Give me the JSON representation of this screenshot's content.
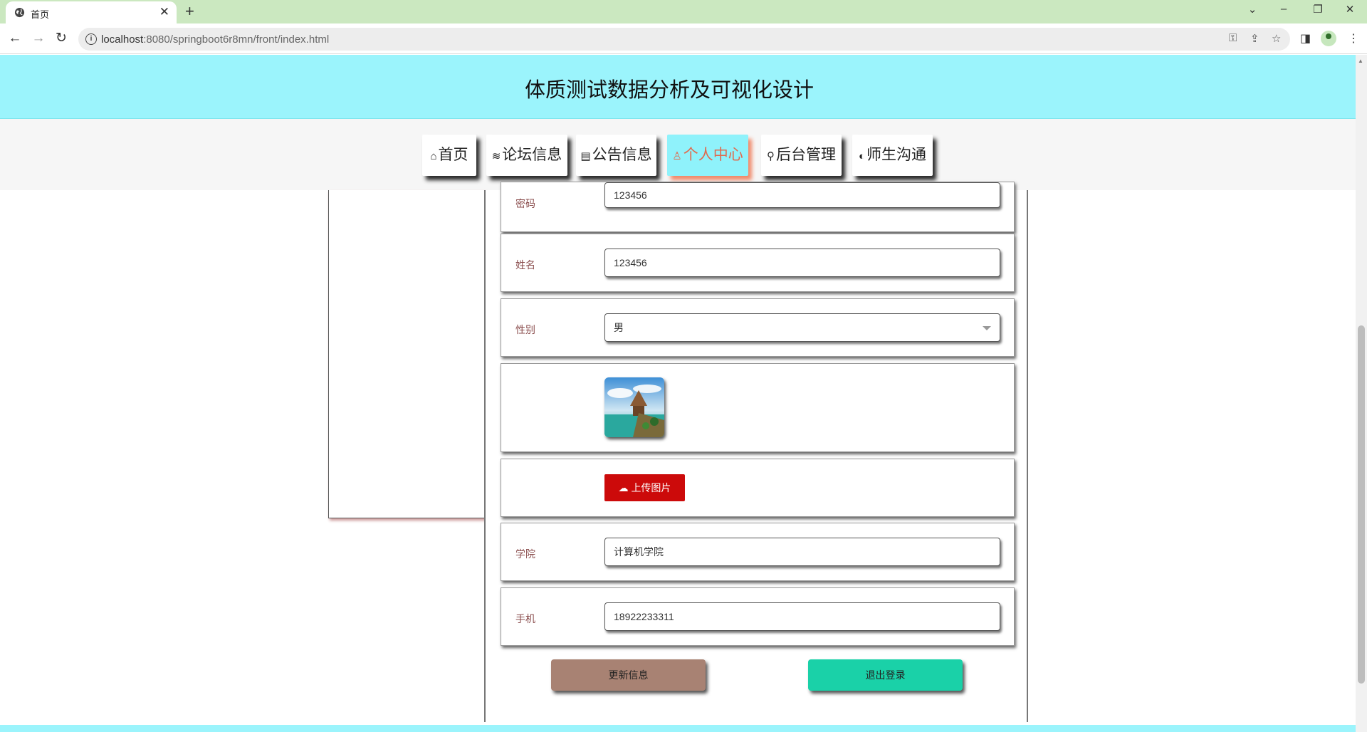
{
  "browser": {
    "tab_title": "首页",
    "tab_close": "✕",
    "new_tab": "+",
    "url_host": "localhost",
    "url_rest": ":8080/springboot6r8mn/front/index.html",
    "controls": {
      "dropdown": "⌄",
      "minimize": "–",
      "restore": "❐",
      "close": "✕"
    },
    "nav": {
      "back": "←",
      "forward": "→",
      "reload": "↻"
    }
  },
  "site": {
    "title": "体质测试数据分析及可视化设计"
  },
  "navbar": {
    "items": [
      {
        "icon": "⌂",
        "label": "首页"
      },
      {
        "icon": "≋",
        "label": "论坛信息"
      },
      {
        "icon": "▤",
        "label": "公告信息"
      },
      {
        "icon": "♙",
        "label": "个人中心"
      },
      {
        "icon": "⚲",
        "label": "后台管理"
      },
      {
        "icon": "◐",
        "label": "师生沟通"
      }
    ],
    "active_index": 3
  },
  "form": {
    "password": {
      "label": "密码",
      "value": "123456"
    },
    "name": {
      "label": "姓名",
      "value": "123456"
    },
    "gender": {
      "label": "性别",
      "value": "男"
    },
    "upload_label": "上传图片",
    "college": {
      "label": "学院",
      "value": "计算机学院"
    },
    "phone": {
      "label": "手机",
      "value": "18922233311"
    },
    "update_button": "更新信息",
    "logout_button": "退出登录"
  },
  "colors": {
    "header_bg": "#9bf4fc",
    "active_tab_text": "#e06a4e",
    "upload_btn": "#cc0a0a",
    "update_btn": "#a88273",
    "logout_btn": "#1ad1a8",
    "label_text": "#8a4d4d"
  }
}
